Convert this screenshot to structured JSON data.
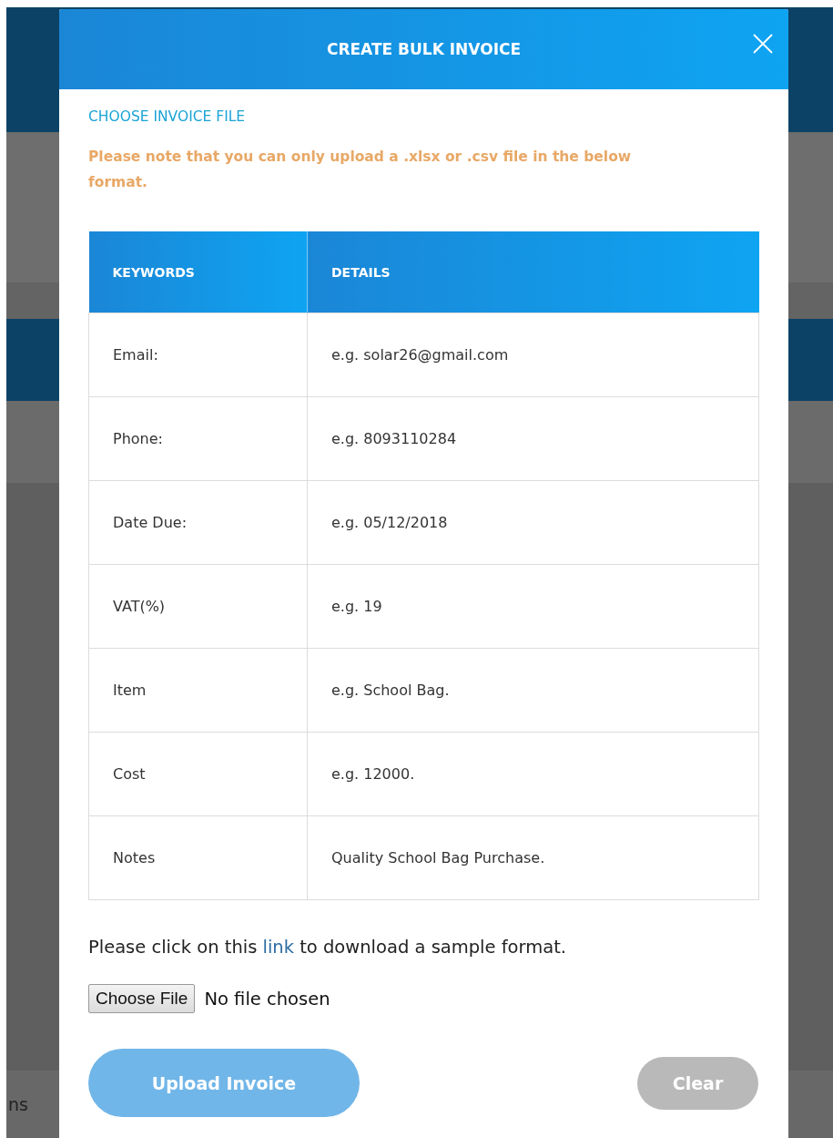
{
  "background": {
    "partial_label": "ns"
  },
  "modal": {
    "title": "CREATE BULK INVOICE",
    "section_heading": "CHOOSE INVOICE FILE",
    "note": "Please note that you can only upload a .xlsx or .csv file in the below format.",
    "table": {
      "columns": [
        "KEYWORDS",
        "DETAILS"
      ],
      "rows": [
        {
          "keyword": "Email:",
          "detail": "e.g. solar26@gmail.com"
        },
        {
          "keyword": "Phone:",
          "detail": "e.g. 8093110284"
        },
        {
          "keyword": "Date Due:",
          "detail": "e.g. 05/12/2018"
        },
        {
          "keyword": "VAT(%)",
          "detail": "e.g. 19"
        },
        {
          "keyword": "Item",
          "detail": "e.g. School Bag."
        },
        {
          "keyword": "Cost",
          "detail": "e.g. 12000."
        },
        {
          "keyword": "Notes",
          "detail": "Quality School Bag Purchase."
        }
      ]
    },
    "sample": {
      "before": "Please click on this",
      "link": "link",
      "after": "to download a sample format."
    },
    "file_input": {
      "button": "Choose File",
      "status": "No file chosen"
    },
    "buttons": [
      {
        "label": "Upload Invoice",
        "kind": "primary",
        "disabled": true
      },
      {
        "label": "Clear",
        "kind": "secondary",
        "disabled": true
      }
    ]
  }
}
